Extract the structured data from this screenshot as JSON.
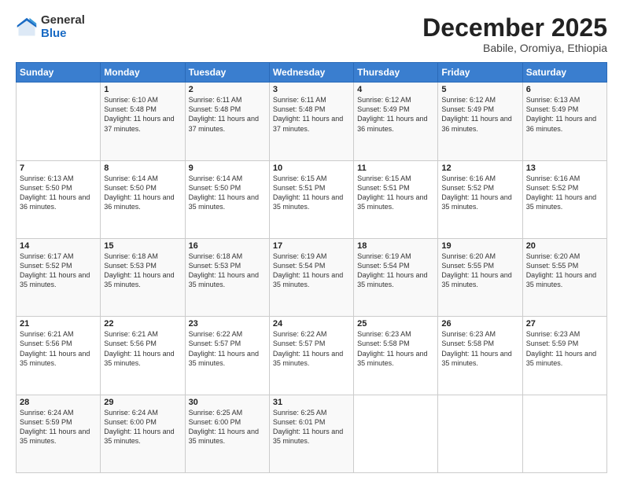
{
  "logo": {
    "general": "General",
    "blue": "Blue"
  },
  "title": "December 2025",
  "subtitle": "Babile, Oromiya, Ethiopia",
  "weekdays": [
    "Sunday",
    "Monday",
    "Tuesday",
    "Wednesday",
    "Thursday",
    "Friday",
    "Saturday"
  ],
  "weeks": [
    [
      {
        "day": "",
        "info": ""
      },
      {
        "day": "1",
        "info": "Sunrise: 6:10 AM\nSunset: 5:48 PM\nDaylight: 11 hours and 37 minutes."
      },
      {
        "day": "2",
        "info": "Sunrise: 6:11 AM\nSunset: 5:48 PM\nDaylight: 11 hours and 37 minutes."
      },
      {
        "day": "3",
        "info": "Sunrise: 6:11 AM\nSunset: 5:48 PM\nDaylight: 11 hours and 37 minutes."
      },
      {
        "day": "4",
        "info": "Sunrise: 6:12 AM\nSunset: 5:49 PM\nDaylight: 11 hours and 36 minutes."
      },
      {
        "day": "5",
        "info": "Sunrise: 6:12 AM\nSunset: 5:49 PM\nDaylight: 11 hours and 36 minutes."
      },
      {
        "day": "6",
        "info": "Sunrise: 6:13 AM\nSunset: 5:49 PM\nDaylight: 11 hours and 36 minutes."
      }
    ],
    [
      {
        "day": "7",
        "info": "Sunrise: 6:13 AM\nSunset: 5:50 PM\nDaylight: 11 hours and 36 minutes."
      },
      {
        "day": "8",
        "info": "Sunrise: 6:14 AM\nSunset: 5:50 PM\nDaylight: 11 hours and 36 minutes."
      },
      {
        "day": "9",
        "info": "Sunrise: 6:14 AM\nSunset: 5:50 PM\nDaylight: 11 hours and 35 minutes."
      },
      {
        "day": "10",
        "info": "Sunrise: 6:15 AM\nSunset: 5:51 PM\nDaylight: 11 hours and 35 minutes."
      },
      {
        "day": "11",
        "info": "Sunrise: 6:15 AM\nSunset: 5:51 PM\nDaylight: 11 hours and 35 minutes."
      },
      {
        "day": "12",
        "info": "Sunrise: 6:16 AM\nSunset: 5:52 PM\nDaylight: 11 hours and 35 minutes."
      },
      {
        "day": "13",
        "info": "Sunrise: 6:16 AM\nSunset: 5:52 PM\nDaylight: 11 hours and 35 minutes."
      }
    ],
    [
      {
        "day": "14",
        "info": "Sunrise: 6:17 AM\nSunset: 5:52 PM\nDaylight: 11 hours and 35 minutes."
      },
      {
        "day": "15",
        "info": "Sunrise: 6:18 AM\nSunset: 5:53 PM\nDaylight: 11 hours and 35 minutes."
      },
      {
        "day": "16",
        "info": "Sunrise: 6:18 AM\nSunset: 5:53 PM\nDaylight: 11 hours and 35 minutes."
      },
      {
        "day": "17",
        "info": "Sunrise: 6:19 AM\nSunset: 5:54 PM\nDaylight: 11 hours and 35 minutes."
      },
      {
        "day": "18",
        "info": "Sunrise: 6:19 AM\nSunset: 5:54 PM\nDaylight: 11 hours and 35 minutes."
      },
      {
        "day": "19",
        "info": "Sunrise: 6:20 AM\nSunset: 5:55 PM\nDaylight: 11 hours and 35 minutes."
      },
      {
        "day": "20",
        "info": "Sunrise: 6:20 AM\nSunset: 5:55 PM\nDaylight: 11 hours and 35 minutes."
      }
    ],
    [
      {
        "day": "21",
        "info": "Sunrise: 6:21 AM\nSunset: 5:56 PM\nDaylight: 11 hours and 35 minutes."
      },
      {
        "day": "22",
        "info": "Sunrise: 6:21 AM\nSunset: 5:56 PM\nDaylight: 11 hours and 35 minutes."
      },
      {
        "day": "23",
        "info": "Sunrise: 6:22 AM\nSunset: 5:57 PM\nDaylight: 11 hours and 35 minutes."
      },
      {
        "day": "24",
        "info": "Sunrise: 6:22 AM\nSunset: 5:57 PM\nDaylight: 11 hours and 35 minutes."
      },
      {
        "day": "25",
        "info": "Sunrise: 6:23 AM\nSunset: 5:58 PM\nDaylight: 11 hours and 35 minutes."
      },
      {
        "day": "26",
        "info": "Sunrise: 6:23 AM\nSunset: 5:58 PM\nDaylight: 11 hours and 35 minutes."
      },
      {
        "day": "27",
        "info": "Sunrise: 6:23 AM\nSunset: 5:59 PM\nDaylight: 11 hours and 35 minutes."
      }
    ],
    [
      {
        "day": "28",
        "info": "Sunrise: 6:24 AM\nSunset: 5:59 PM\nDaylight: 11 hours and 35 minutes."
      },
      {
        "day": "29",
        "info": "Sunrise: 6:24 AM\nSunset: 6:00 PM\nDaylight: 11 hours and 35 minutes."
      },
      {
        "day": "30",
        "info": "Sunrise: 6:25 AM\nSunset: 6:00 PM\nDaylight: 11 hours and 35 minutes."
      },
      {
        "day": "31",
        "info": "Sunrise: 6:25 AM\nSunset: 6:01 PM\nDaylight: 11 hours and 35 minutes."
      },
      {
        "day": "",
        "info": ""
      },
      {
        "day": "",
        "info": ""
      },
      {
        "day": "",
        "info": ""
      }
    ]
  ]
}
